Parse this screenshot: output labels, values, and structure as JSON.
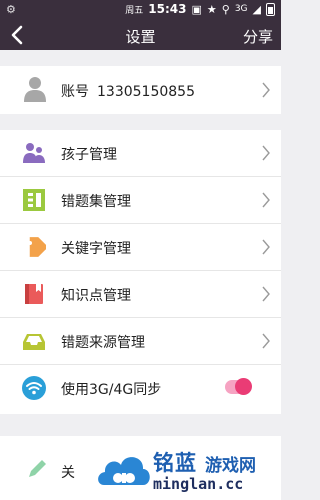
{
  "status_bar": {
    "weekday": "周五",
    "time": "15:43",
    "network": "3G"
  },
  "header": {
    "title": "设置",
    "share_label": "分享"
  },
  "account": {
    "label": "账号",
    "phone": "13305150855"
  },
  "menu": {
    "items": [
      {
        "label": "孩子管理",
        "icon": "children-icon",
        "color": "#8a6bbf"
      },
      {
        "label": "错题集管理",
        "icon": "wrong-set-icon",
        "color": "#9bc93f"
      },
      {
        "label": "关键字管理",
        "icon": "tag-icon",
        "color": "#f3a24a"
      },
      {
        "label": "知识点管理",
        "icon": "book-icon",
        "color": "#ea5a5a"
      },
      {
        "label": "错题来源管理",
        "icon": "tray-icon",
        "color": "#b7c534"
      },
      {
        "label": "使用3G/4G同步",
        "icon": "wifi-icon",
        "color": "#2a9fd8",
        "toggle": true,
        "toggle_on": true
      }
    ]
  },
  "bottom": {
    "label": "关"
  },
  "watermark": {
    "brand_cn": "铭蓝",
    "brand_sub": "游戏网",
    "url": "minglan.cc"
  }
}
